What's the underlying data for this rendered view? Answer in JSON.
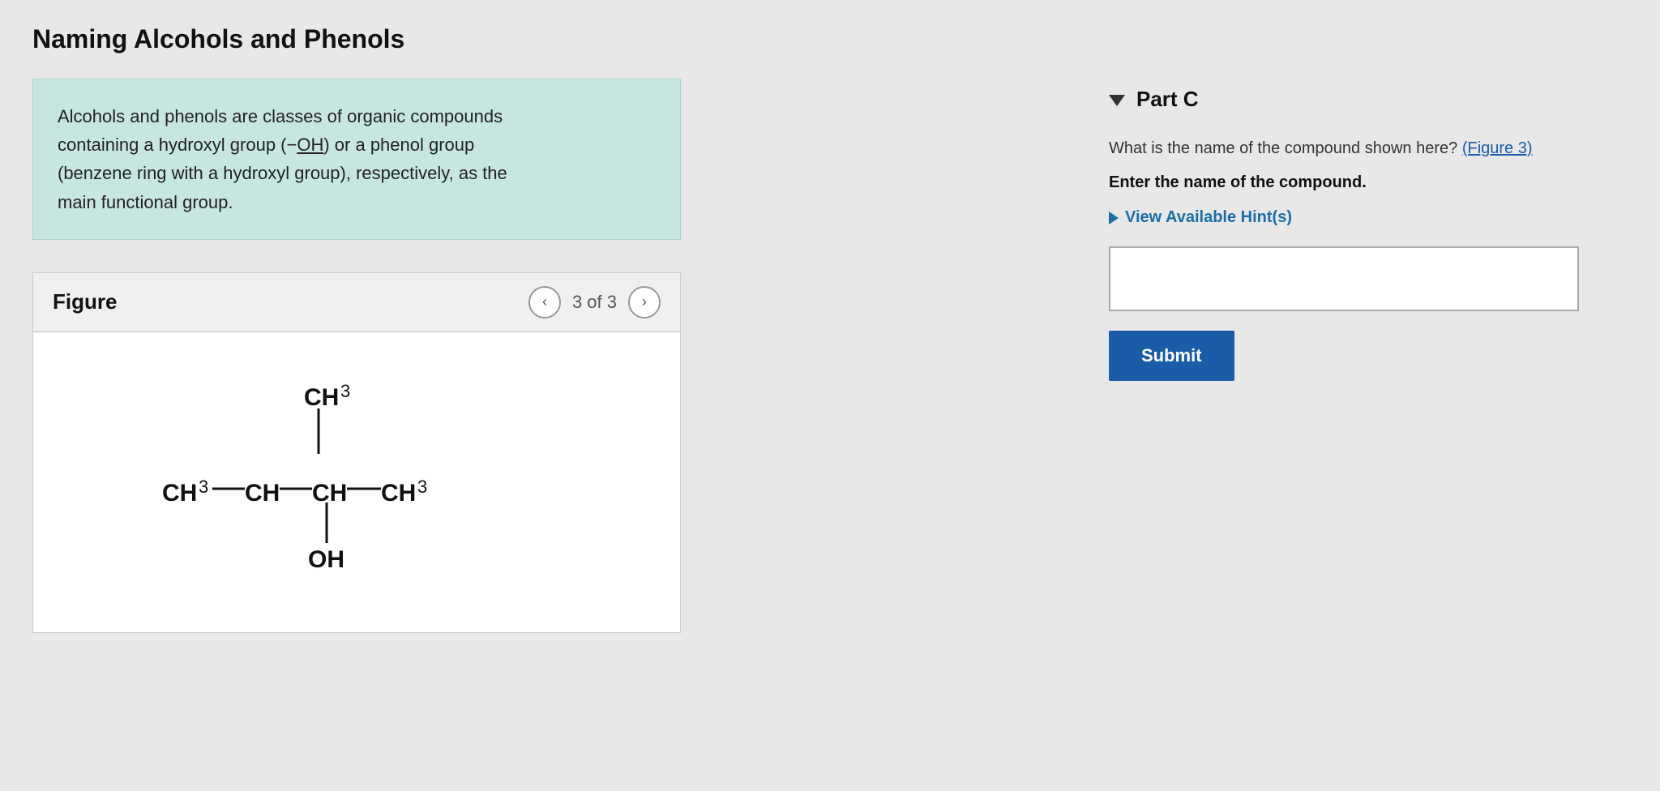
{
  "page": {
    "title": "Naming Alcohols and Phenols"
  },
  "info_box": {
    "text": "Alcohols and phenols are classes of organic compounds containing a hydroxyl group (−OH) or a phenol group (benzene ring with a hydroxyl group), respectively, as the main functional group."
  },
  "figure": {
    "label": "Figure",
    "nav_text": "3 of 3",
    "prev_aria": "previous figure",
    "next_aria": "next figure"
  },
  "right_panel": {
    "part_label": "Part C",
    "question": "What is the name of the compound shown here?",
    "figure_link": "(Figure 3)",
    "instruction": "Enter the name of the compound.",
    "hints_label": "View Available Hint(s)",
    "answer_placeholder": "",
    "submit_label": "Submit"
  }
}
